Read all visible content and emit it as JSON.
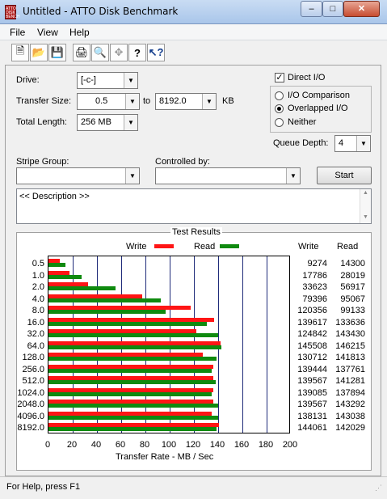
{
  "window": {
    "title": "Untitled - ATTO Disk Benchmark",
    "icon_label": "ATTO DISK BENCH"
  },
  "menu": {
    "file": "File",
    "view": "View",
    "help": "Help"
  },
  "toolbar": [
    "new-icon",
    "open-icon",
    "save-icon",
    "print-icon",
    "print-preview-icon",
    "move-icon",
    "help-icon",
    "context-help-icon"
  ],
  "form": {
    "drive_label": "Drive:",
    "drive_value": "[-c-]",
    "transfer_label": "Transfer Size:",
    "transfer_from": "0.5",
    "to_label": "to",
    "transfer_to": "8192.0",
    "kb_label": "KB",
    "total_label": "Total Length:",
    "total_value": "256 MB",
    "direct_io": "Direct I/O",
    "io_comparison": "I/O Comparison",
    "overlapped_io": "Overlapped I/O",
    "neither": "Neither",
    "queue_label": "Queue Depth:",
    "queue_value": "4",
    "stripe_label": "Stripe Group:",
    "controlled_label": "Controlled by:",
    "start_button": "Start",
    "description": "<< Description >>"
  },
  "results": {
    "title": "Test Results",
    "legend_write": "Write",
    "legend_read": "Read",
    "col_write": "Write",
    "col_read": "Read",
    "x_axis_title": "Transfer Rate - MB / Sec",
    "x_ticks": [
      "0",
      "20",
      "40",
      "60",
      "80",
      "100",
      "120",
      "140",
      "160",
      "180",
      "200"
    ]
  },
  "chart_data": {
    "type": "bar",
    "orientation": "horizontal",
    "title": "Test Results",
    "xlabel": "Transfer Rate - MB / Sec",
    "xlim": [
      0,
      200
    ],
    "categories": [
      "0.5",
      "1.0",
      "2.0",
      "4.0",
      "8.0",
      "16.0",
      "32.0",
      "64.0",
      "128.0",
      "256.0",
      "512.0",
      "1024.0",
      "2048.0",
      "4096.0",
      "8192.0"
    ],
    "series": [
      {
        "name": "Write",
        "color": "#ff1515",
        "values": [
          9274,
          17786,
          33623,
          79396,
          120356,
          139617,
          124842,
          145508,
          130712,
          139444,
          139567,
          139085,
          139567,
          138131,
          144061
        ]
      },
      {
        "name": "Read",
        "color": "#0f8a0f",
        "values": [
          14300,
          28019,
          56917,
          95067,
          99133,
          133636,
          143430,
          146215,
          141813,
          137761,
          141281,
          137894,
          143292,
          143038,
          142029
        ]
      }
    ]
  },
  "status": {
    "text": "For Help, press F1"
  }
}
